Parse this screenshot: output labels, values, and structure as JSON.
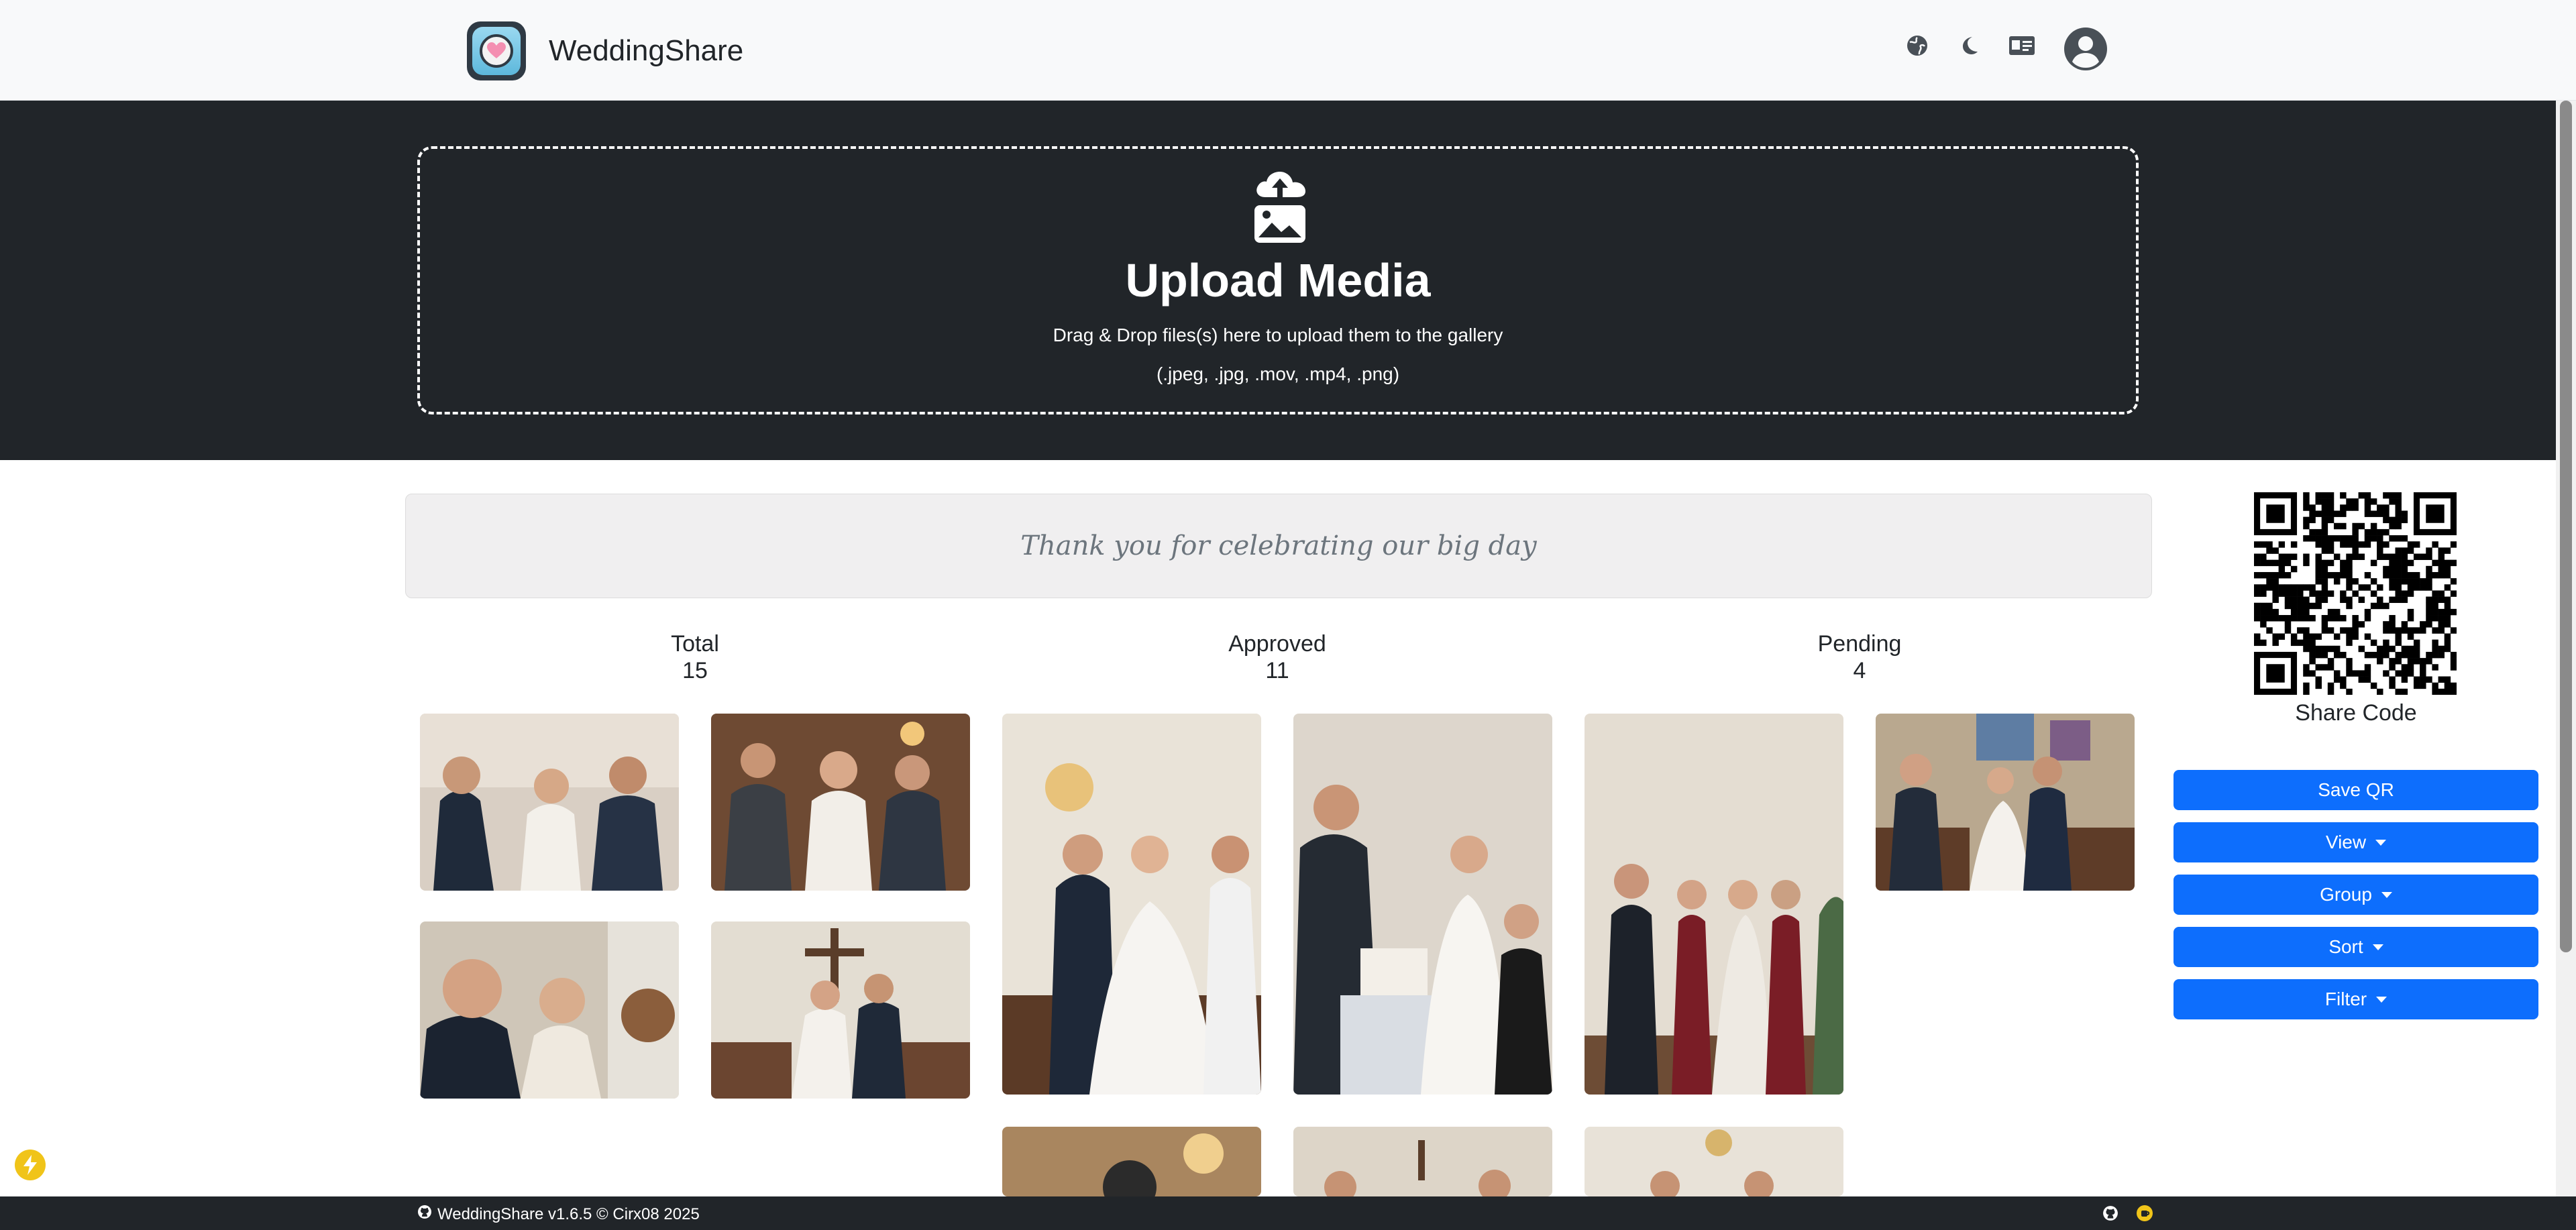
{
  "app": {
    "title": "WeddingShare"
  },
  "navbar": {
    "icons": [
      "globe-icon",
      "moon-icon",
      "id-card-icon"
    ],
    "avatar_icon": "user-circle-icon"
  },
  "upload": {
    "icon": "cloud-upload-image-icon",
    "title": "Upload Media",
    "subtitle": "Drag & Drop files(s) here to upload them to the gallery",
    "types": "(.jpeg, .jpg, .mov, .mp4, .png)"
  },
  "welcome": {
    "message": "Thank you for celebrating our big day"
  },
  "stats": [
    {
      "label": "Total",
      "value": "15"
    },
    {
      "label": "Approved",
      "value": "11"
    },
    {
      "label": "Pending",
      "value": "4"
    }
  ],
  "gallery": {
    "photos": [
      {
        "name": "photo-guests-clapping"
      },
      {
        "name": "photo-bride-toasting"
      },
      {
        "name": "photo-first-dance"
      },
      {
        "name": "photo-cake-cutting"
      },
      {
        "name": "photo-bridal-party"
      },
      {
        "name": "photo-church-walk"
      },
      {
        "name": "photo-couple-smiling"
      },
      {
        "name": "photo-aisle-celebration"
      },
      {
        "name": "photo-reception-hall"
      },
      {
        "name": "photo-chapel-guests"
      },
      {
        "name": "photo-chandelier-party"
      }
    ]
  },
  "sidebar": {
    "share_code_label": "Share Code",
    "buttons": {
      "save_qr": "Save QR",
      "view": "View",
      "group": "Group",
      "sort": "Sort",
      "filter": "Filter"
    }
  },
  "footer": {
    "text": "WeddingShare v1.6.5 © Cirx08 2025",
    "icons": [
      "github-icon",
      "coffee-icon"
    ]
  },
  "colors": {
    "primary": "#0d6efd",
    "dark": "#212529",
    "light": "#f8f9fa",
    "accent": "#f0c419"
  }
}
